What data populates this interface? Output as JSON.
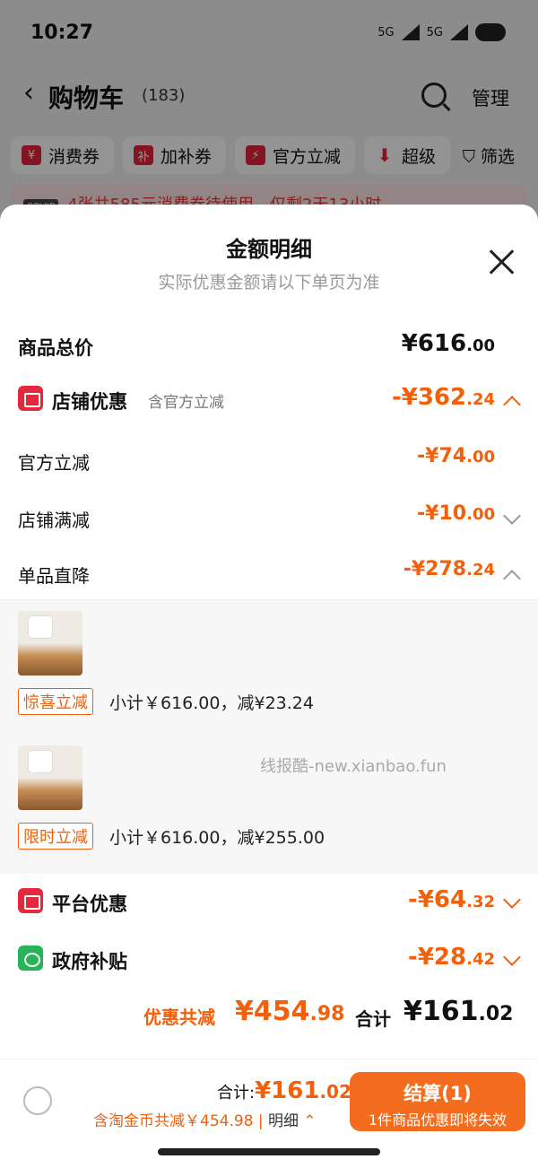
{
  "status_bar": {
    "time": "10:27",
    "net1": "5G",
    "net2": "5G"
  },
  "cart": {
    "title": "购物车",
    "count": "(183)",
    "manage": "管理",
    "chips": [
      "消费券",
      "加补券",
      "官方立减",
      "超级"
    ],
    "chip_icons": [
      "¥",
      "补",
      "⚡",
      "⬇"
    ],
    "filter": "筛选",
    "vip_badge": "88VIP",
    "vip_text": "4张共585元消费券待使用，仅剩2天13小时"
  },
  "sheet": {
    "title": "金额明细",
    "subtitle": "实际优惠金额请以下单页为准",
    "total_label": "商品总价",
    "total": {
      "int": "¥616",
      "dec": ".00"
    },
    "shop_discount": {
      "label": "店铺优惠",
      "note": "含官方立减",
      "int": "-¥362",
      "dec": ".24"
    },
    "official": {
      "label": "官方立减",
      "int": "-¥74",
      "dec": ".00"
    },
    "shop_full": {
      "label": "店铺满减",
      "int": "-¥10",
      "dec": ".00"
    },
    "single_drop": {
      "label": "单品直降",
      "int": "-¥278",
      "dec": ".24"
    },
    "products": [
      {
        "tag": "惊喜立减",
        "text": "小计￥616.00，减¥23.24"
      },
      {
        "tag": "限时立减",
        "text": "小计￥616.00，减¥255.00"
      }
    ],
    "watermark": "线报酷-new.xianbao.fun",
    "platform": {
      "label": "平台优惠",
      "int": "-¥64",
      "dec": ".32"
    },
    "gov": {
      "label": "政府补贴",
      "int": "-¥28",
      "dec": ".42"
    },
    "sum_saved_label": "优惠共减",
    "sum_saved": {
      "int": "¥454",
      "dec": ".98"
    },
    "sum_total_label": "合计",
    "sum_total": {
      "int": "¥161",
      "dec": ".02"
    }
  },
  "bottom": {
    "total_label": "合计:",
    "total": {
      "int": "¥161",
      "dec": ".02"
    },
    "saved_text": "含淘金币共减￥454.98",
    "detail": "明细",
    "checkout_label": "结算(1)",
    "checkout_sub": "1件商品优惠即将失效"
  }
}
